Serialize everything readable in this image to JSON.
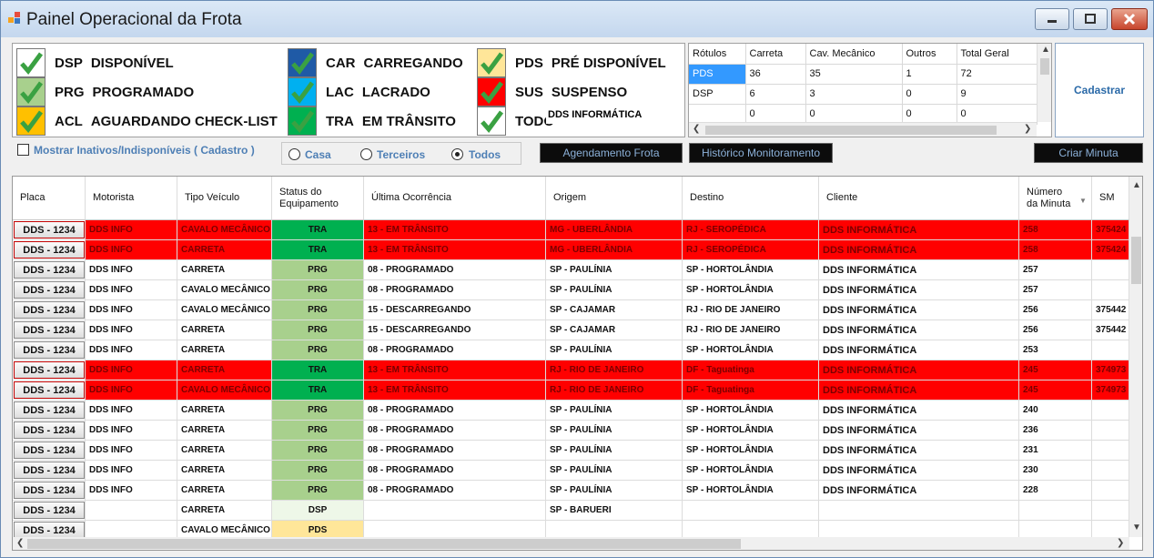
{
  "window": {
    "title": "Painel Operacional da Frota"
  },
  "legend": [
    {
      "code": "DSP",
      "label": "DISPONÍVEL",
      "color": "#ffffff"
    },
    {
      "code": "PRG",
      "label": "PROGRAMADO",
      "color": "#a8d08d"
    },
    {
      "code": "ACL",
      "label": "AGUARDANDO CHECK-LIST",
      "color": "#ffc000"
    },
    {
      "code": "CAR",
      "label": "CARREGANDO",
      "color": "#1f5aa6"
    },
    {
      "code": "LAC",
      "label": "LACRADO",
      "color": "#00b0f0"
    },
    {
      "code": "TRA",
      "label": "EM TRÂNSITO",
      "color": "#00b050"
    },
    {
      "code": "PDS",
      "label": "PRÉ DISPONÍVEL",
      "color": "#ffe699"
    },
    {
      "code": "SUS",
      "label": "SUSPENSO",
      "color": "#ff0000"
    },
    {
      "code": "TODO",
      "label": "",
      "color": "#ffffff"
    }
  ],
  "legend_overlay_text": "DDS INFORMÁTICA",
  "pivot": {
    "headers": [
      "Rótulos",
      "Carreta",
      "Cav. Mecânico",
      "Outros",
      "Total Geral"
    ],
    "rows": [
      [
        "PDS",
        "36",
        "35",
        "1",
        "72"
      ],
      [
        "DSP",
        "6",
        "3",
        "0",
        "9"
      ],
      [
        "",
        "0",
        "0",
        "0",
        "0"
      ]
    ]
  },
  "buttons": {
    "cadastrar": "Cadastrar",
    "agendamento": "Agendamento Frota",
    "historico": "Histórico Monitoramento",
    "criar_minuta": "Criar Minuta"
  },
  "filters": {
    "mostrar_inativos": "Mostrar Inativos/Indisponíveis ( Cadastro )",
    "radios": [
      {
        "label": "Casa",
        "selected": false
      },
      {
        "label": "Terceiros",
        "selected": false
      },
      {
        "label": "Todos",
        "selected": true
      }
    ]
  },
  "colors": {
    "red_row": "#ff0000",
    "tra": "#00b050",
    "prg": "#a8d08d",
    "dsp": "#eef7e8",
    "pds": "#ffe699",
    "red_cell_text": "#7a0000"
  },
  "grid": {
    "columns": [
      "Placa",
      "Motorista",
      "Tipo Veículo",
      "Status do Equipamento",
      "Última Ocorrência",
      "Origem",
      "Destino",
      "Cliente",
      "Número da Minuta",
      "SM"
    ],
    "rows": [
      {
        "placa": "DDS - 1234",
        "motorista": "DDS INFO",
        "tipo": "CAVALO MECÂNICO",
        "status": "TRA",
        "ocorrencia": "13 - EM TRÂNSITO",
        "origem": "MG - UBERLÂNDIA",
        "destino": "RJ - SEROPÉDICA",
        "cliente": "DDS INFORMÁTICA",
        "minuta": "258",
        "sm": "375424",
        "red": true
      },
      {
        "placa": "DDS - 1234",
        "motorista": "DDS INFO",
        "tipo": "CARRETA",
        "status": "TRA",
        "ocorrencia": "13 - EM TRÂNSITO",
        "origem": "MG - UBERLÂNDIA",
        "destino": "RJ - SEROPÉDICA",
        "cliente": "DDS INFORMÁTICA",
        "minuta": "258",
        "sm": "375424",
        "red": true
      },
      {
        "placa": "DDS - 1234",
        "motorista": "DDS INFO",
        "tipo": "CARRETA",
        "status": "PRG",
        "ocorrencia": "08 - PROGRAMADO",
        "origem": "SP - PAULÍNIA",
        "destino": "SP - HORTOLÂNDIA",
        "cliente": "DDS INFORMÁTICA",
        "minuta": "257",
        "sm": "",
        "red": false
      },
      {
        "placa": "DDS - 1234",
        "motorista": "DDS INFO",
        "tipo": "CAVALO MECÂNICO",
        "status": "PRG",
        "ocorrencia": "08 - PROGRAMADO",
        "origem": "SP - PAULÍNIA",
        "destino": "SP - HORTOLÂNDIA",
        "cliente": "DDS INFORMÁTICA",
        "minuta": "257",
        "sm": "",
        "red": false
      },
      {
        "placa": "DDS - 1234",
        "motorista": "DDS INFO",
        "tipo": "CAVALO MECÂNICO",
        "status": "PRG",
        "ocorrencia": "15 - DESCARREGANDO",
        "origem": "SP - CAJAMAR",
        "destino": "RJ - RIO DE JANEIRO",
        "cliente": "DDS INFORMÁTICA",
        "minuta": "256",
        "sm": "375442",
        "red": false
      },
      {
        "placa": "DDS - 1234",
        "motorista": "DDS INFO",
        "tipo": "CARRETA",
        "status": "PRG",
        "ocorrencia": "15 - DESCARREGANDO",
        "origem": "SP - CAJAMAR",
        "destino": "RJ - RIO DE JANEIRO",
        "cliente": "DDS INFORMÁTICA",
        "minuta": "256",
        "sm": "375442",
        "red": false
      },
      {
        "placa": "DDS - 1234",
        "motorista": "DDS INFO",
        "tipo": "CARRETA",
        "status": "PRG",
        "ocorrencia": "08 - PROGRAMADO",
        "origem": "SP - PAULÍNIA",
        "destino": "SP - HORTOLÂNDIA",
        "cliente": "DDS INFORMÁTICA",
        "minuta": "253",
        "sm": "",
        "red": false
      },
      {
        "placa": "DDS - 1234",
        "motorista": "DDS INFO",
        "tipo": "CARRETA",
        "status": "TRA",
        "ocorrencia": "13 - EM TRÂNSITO",
        "origem": "RJ - RIO DE JANEIRO",
        "destino": "DF - Taguatinga",
        "cliente": "DDS INFORMÁTICA",
        "minuta": "245",
        "sm": "374973",
        "red": true
      },
      {
        "placa": "DDS - 1234",
        "motorista": "DDS INFO",
        "tipo": "CAVALO MECÂNICO",
        "status": "TRA",
        "ocorrencia": "13 - EM TRÂNSITO",
        "origem": "RJ - RIO DE JANEIRO",
        "destino": "DF - Taguatinga",
        "cliente": "DDS INFORMÁTICA",
        "minuta": "245",
        "sm": "374973",
        "red": true
      },
      {
        "placa": "DDS - 1234",
        "motorista": "DDS INFO",
        "tipo": "CARRETA",
        "status": "PRG",
        "ocorrencia": "08 - PROGRAMADO",
        "origem": "SP - PAULÍNIA",
        "destino": "SP - HORTOLÂNDIA",
        "cliente": "DDS INFORMÁTICA",
        "minuta": "240",
        "sm": "",
        "red": false
      },
      {
        "placa": "DDS - 1234",
        "motorista": "DDS INFO",
        "tipo": "CARRETA",
        "status": "PRG",
        "ocorrencia": "08 - PROGRAMADO",
        "origem": "SP - PAULÍNIA",
        "destino": "SP - HORTOLÂNDIA",
        "cliente": "DDS INFORMÁTICA",
        "minuta": "236",
        "sm": "",
        "red": false
      },
      {
        "placa": "DDS - 1234",
        "motorista": "DDS INFO",
        "tipo": "CARRETA",
        "status": "PRG",
        "ocorrencia": "08 - PROGRAMADO",
        "origem": "SP - PAULÍNIA",
        "destino": "SP - HORTOLÂNDIA",
        "cliente": "DDS INFORMÁTICA",
        "minuta": "231",
        "sm": "",
        "red": false
      },
      {
        "placa": "DDS - 1234",
        "motorista": "DDS INFO",
        "tipo": "CARRETA",
        "status": "PRG",
        "ocorrencia": "08 - PROGRAMADO",
        "origem": "SP - PAULÍNIA",
        "destino": "SP - HORTOLÂNDIA",
        "cliente": "DDS INFORMÁTICA",
        "minuta": "230",
        "sm": "",
        "red": false
      },
      {
        "placa": "DDS - 1234",
        "motorista": "DDS INFO",
        "tipo": "CARRETA",
        "status": "PRG",
        "ocorrencia": "08 - PROGRAMADO",
        "origem": "SP - PAULÍNIA",
        "destino": "SP - HORTOLÂNDIA",
        "cliente": "DDS INFORMÁTICA",
        "minuta": "228",
        "sm": "",
        "red": false
      },
      {
        "placa": "DDS - 1234",
        "motorista": "",
        "tipo": "CARRETA",
        "status": "DSP",
        "ocorrencia": "",
        "origem": "SP - BARUERI",
        "destino": "",
        "cliente": "",
        "minuta": "",
        "sm": "",
        "red": false
      },
      {
        "placa": "DDS - 1234",
        "motorista": "",
        "tipo": "CAVALO MECÂNICO",
        "status": "PDS",
        "ocorrencia": "",
        "origem": "",
        "destino": "",
        "cliente": "",
        "minuta": "",
        "sm": "",
        "red": false
      }
    ]
  }
}
